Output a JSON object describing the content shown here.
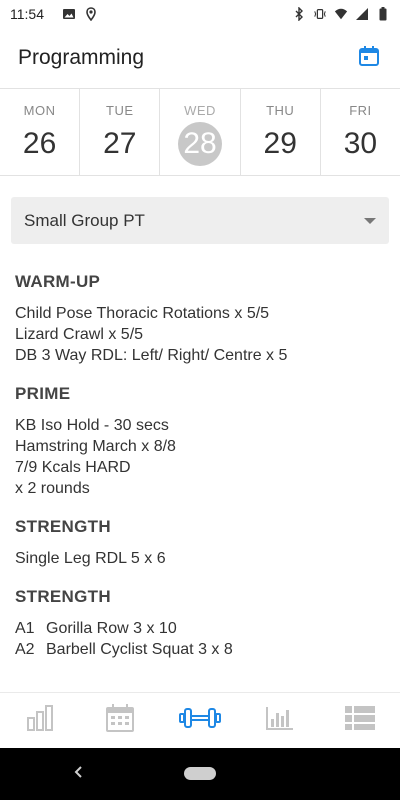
{
  "status_bar": {
    "time": "11:54",
    "left_icons": [
      "image-icon",
      "location-icon"
    ],
    "right_icons": [
      "bluetooth-icon",
      "vibrate-icon",
      "wifi-icon",
      "signal-icon",
      "battery-icon"
    ]
  },
  "header": {
    "title": "Programming",
    "calendar_icon": "calendar-icon",
    "accent_color": "#1e88e5"
  },
  "days": [
    {
      "name": "MON",
      "number": "26",
      "selected": false
    },
    {
      "name": "TUE",
      "number": "27",
      "selected": false
    },
    {
      "name": "WED",
      "number": "28",
      "selected": true
    },
    {
      "name": "THU",
      "number": "29",
      "selected": false
    },
    {
      "name": "FRI",
      "number": "30",
      "selected": false
    }
  ],
  "class_select": {
    "value": "Small Group PT"
  },
  "workout": {
    "warmup": {
      "title": "WARM-UP",
      "lines": [
        "Child Pose Thoracic Rotations x 5/5",
        "Lizard Crawl x 5/5",
        "DB 3 Way RDL: Left/ Right/ Centre x 5"
      ]
    },
    "prime": {
      "title": "PRIME",
      "lines": [
        "KB Iso Hold - 30 secs",
        "Hamstring March x 8/8",
        "7/9 Kcals HARD",
        "x 2 rounds"
      ]
    },
    "strength1": {
      "title": "STRENGTH",
      "lines": [
        "Single Leg RDL 5 x 6"
      ]
    },
    "strength2": {
      "title": "STRENGTH",
      "items": [
        {
          "code": "A1",
          "text": "Gorilla Row 3 x 10"
        },
        {
          "code": "A2",
          "text": "Barbell Cyclist Squat 3 x 8"
        }
      ]
    }
  },
  "bottom_nav": {
    "items": [
      "progress-icon",
      "schedule-icon",
      "workout-icon",
      "stats-icon",
      "list-icon"
    ],
    "active": "workout-icon",
    "active_color": "#1e88e5",
    "inactive_color": "#c4c4c4"
  }
}
